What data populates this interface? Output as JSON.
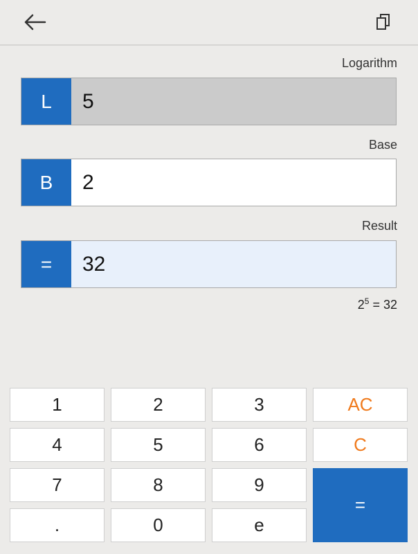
{
  "fields": {
    "logarithm": {
      "label": "Logarithm",
      "tag": "L",
      "value": "5"
    },
    "base": {
      "label": "Base",
      "tag": "B",
      "value": "2"
    },
    "result": {
      "label": "Result",
      "tag": "=",
      "value": "32"
    }
  },
  "equation": {
    "base": "2",
    "exponent": "5",
    "rest": " = 32"
  },
  "keypad": {
    "k1": "1",
    "k2": "2",
    "k3": "3",
    "ac": "AC",
    "k4": "4",
    "k5": "5",
    "k6": "6",
    "c": "C",
    "k7": "7",
    "k8": "8",
    "k9": "9",
    "equals": "=",
    "dot": ".",
    "k0": "0",
    "e": "e"
  },
  "icons": {
    "back": "arrow-left-icon",
    "copy": "copy-icon"
  },
  "colors": {
    "accent": "#1f6cbf",
    "clear": "#f07a1c"
  }
}
